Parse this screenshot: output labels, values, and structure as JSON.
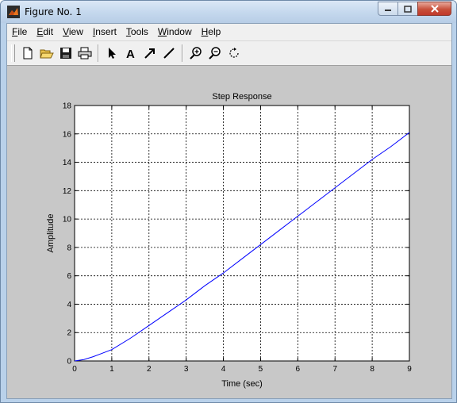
{
  "window": {
    "title": "Figure No. 1"
  },
  "menu": {
    "items": [
      {
        "key": "F",
        "rest": "ile"
      },
      {
        "key": "E",
        "rest": "dit"
      },
      {
        "key": "V",
        "rest": "iew"
      },
      {
        "key": "I",
        "rest": "nsert"
      },
      {
        "key": "T",
        "rest": "ools"
      },
      {
        "key": "W",
        "rest": "indow"
      },
      {
        "key": "H",
        "rest": "elp"
      }
    ]
  },
  "toolbar": {
    "icons": [
      "new-file-icon",
      "open-folder-icon",
      "save-icon",
      "print-icon",
      "select-arrow-icon",
      "insert-text-icon",
      "insert-arrow-icon",
      "insert-line-icon",
      "zoom-in-icon",
      "zoom-out-icon",
      "rotate-3d-icon"
    ]
  },
  "colors": {
    "line": "#0000ff",
    "grid": "#000000",
    "figure_bg": "#c8c8c8"
  },
  "chart_data": {
    "type": "line",
    "title": "Step Response",
    "xlabel": "Time (sec)",
    "ylabel": "Amplitude",
    "xlim": [
      0,
      9
    ],
    "ylim": [
      0,
      18
    ],
    "xticks": [
      "0",
      "1",
      "2",
      "3",
      "4",
      "5",
      "6",
      "7",
      "8",
      "9"
    ],
    "yticks": [
      "0",
      "2",
      "4",
      "6",
      "8",
      "10",
      "12",
      "14",
      "16",
      "18"
    ],
    "grid": true,
    "series": [
      {
        "x": [
          0,
          0.25,
          0.5,
          0.75,
          1,
          1.5,
          2,
          2.5,
          3,
          3.5,
          4,
          4.5,
          5,
          5.5,
          6,
          6.5,
          7,
          7.5,
          8,
          8.5,
          9
        ],
        "y": [
          0,
          0.1,
          0.3,
          0.55,
          0.8,
          1.6,
          2.5,
          3.4,
          4.3,
          5.3,
          6.2,
          7.2,
          8.2,
          9.2,
          10.2,
          11.2,
          12.2,
          13.2,
          14.2,
          15.1,
          16.1
        ]
      }
    ]
  }
}
